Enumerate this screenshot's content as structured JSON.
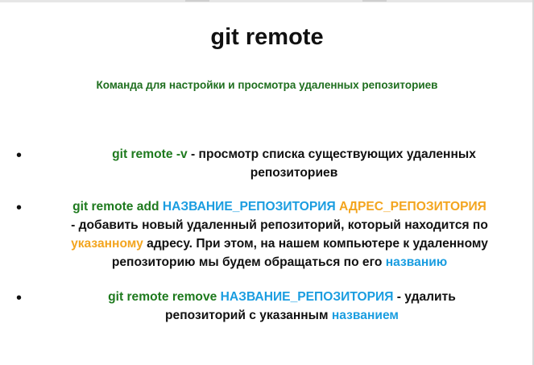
{
  "slide": {
    "title": "git remote",
    "subtitle": "Команда для настройки и просмотра удаленных репозиториев",
    "colors": {
      "command": "#1e7a1e",
      "subtitle": "#1e6e1e",
      "name_highlight": "#1a9de0",
      "address_highlight": "#f3a51f",
      "text": "#111111"
    },
    "bullet_glyph": "•",
    "items": [
      {
        "command": "git remote -v",
        "text_1": " - просмотр списка существующих удаленных",
        "text_2": "репозиториев"
      },
      {
        "command": "git remote add",
        "name_placeholder": "НАЗВАНИЕ_РЕПОЗИТОРИЯ",
        "address_placeholder": "АДРЕС_РЕПОЗИТОРИЯ",
        "text_1": "- добавить новый удаленный репозиторий, который находится по",
        "highlight_address": "указанному",
        "text_2": " адресу. При этом, на нашем компьютере к удаленному",
        "text_3": "репозиторию мы будем обращаться по его ",
        "highlight_name": "названию"
      },
      {
        "command": "git remote remove",
        "name_placeholder": "НАЗВАНИЕ_РЕПОЗИТОРИЯ",
        "text_1": " - удалить",
        "text_2": "репозиторий с указанным ",
        "highlight_name": "названием"
      }
    ]
  }
}
